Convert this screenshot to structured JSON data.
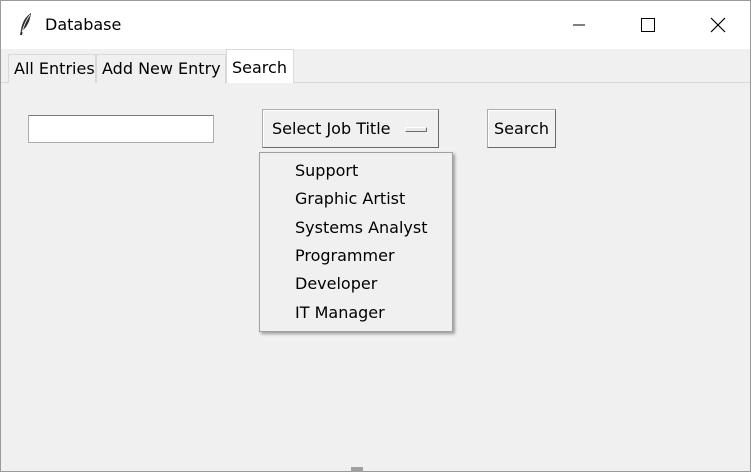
{
  "window": {
    "title": "Database",
    "app_icon": "feather-icon",
    "controls": {
      "minimize": "minimize-icon",
      "maximize": "maximize-icon",
      "close": "close-icon"
    }
  },
  "tabs": [
    {
      "label": "All Entries",
      "active": false
    },
    {
      "label": "Add New Entry",
      "active": false
    },
    {
      "label": "Search",
      "active": true
    }
  ],
  "search_panel": {
    "search_input_value": "",
    "job_title_menu": {
      "label": "Select Job Title",
      "options": [
        "Support",
        "Graphic Artist",
        "Systems Analyst",
        "Programmer",
        "Developer",
        "IT Manager"
      ],
      "open": true
    },
    "search_button_label": "Search"
  },
  "colors": {
    "window_bg": "#f0f0f0",
    "titlebar_bg": "#ffffff",
    "active_tab_bg": "#ffffff",
    "border": "#adadad"
  }
}
